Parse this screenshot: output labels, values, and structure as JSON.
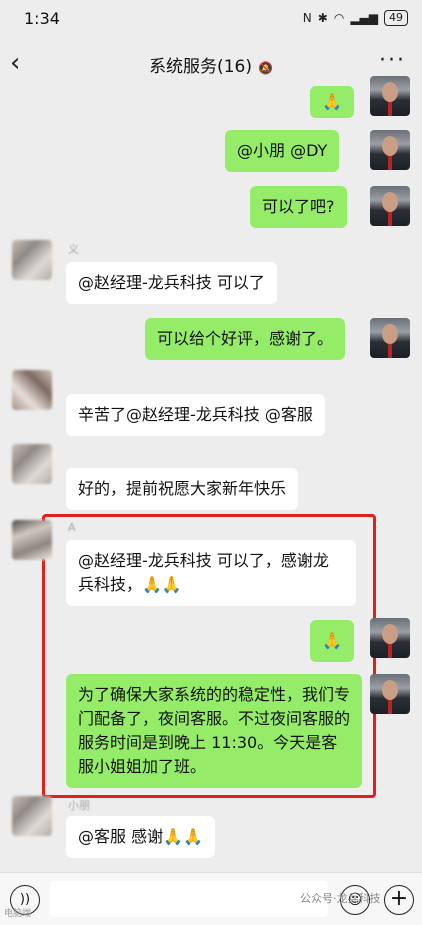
{
  "status": {
    "time": "1:34",
    "battery": "49",
    "icons": [
      "nfc-icon",
      "bluetooth-icon",
      "wifi-icon",
      "signal-icon"
    ]
  },
  "header": {
    "title": "系统服务(16)",
    "back_icon": "chevron-left-icon",
    "more_icon": "more-dots-icon",
    "mute_icon": "bell-mute-icon"
  },
  "messages": [
    {
      "side": "right",
      "text": "🙏"
    },
    {
      "side": "right",
      "text": "@小朋 @DY"
    },
    {
      "side": "right",
      "text": "可以了吧?"
    },
    {
      "side": "left",
      "nick": "义",
      "text": "@赵经理-龙兵科技  可以了"
    },
    {
      "side": "right",
      "text": "可以给个好评，感谢了。"
    },
    {
      "side": "left",
      "nick": "",
      "text": "辛苦了@赵经理-龙兵科技 @客服"
    },
    {
      "side": "left",
      "nick": "",
      "text": "好的，提前祝愿大家新年快乐"
    },
    {
      "side": "left",
      "nick": "A",
      "text": "@赵经理-龙兵科技  可以了，感谢龙兵科技，🙏🙏"
    },
    {
      "side": "right",
      "text": "🙏"
    },
    {
      "side": "right",
      "text": "为了确保大家系统的的稳定性，我们专门配备了，夜间客服。不过夜间客服的服务时间是到晚上 11:30。今天是客服小姐姐加了班。"
    },
    {
      "side": "left",
      "nick": "小朋",
      "text": "@客服  感谢🙏🙏"
    }
  ],
  "watermark": "公众号·龙兵科技",
  "watermark_small": "电脑端"
}
